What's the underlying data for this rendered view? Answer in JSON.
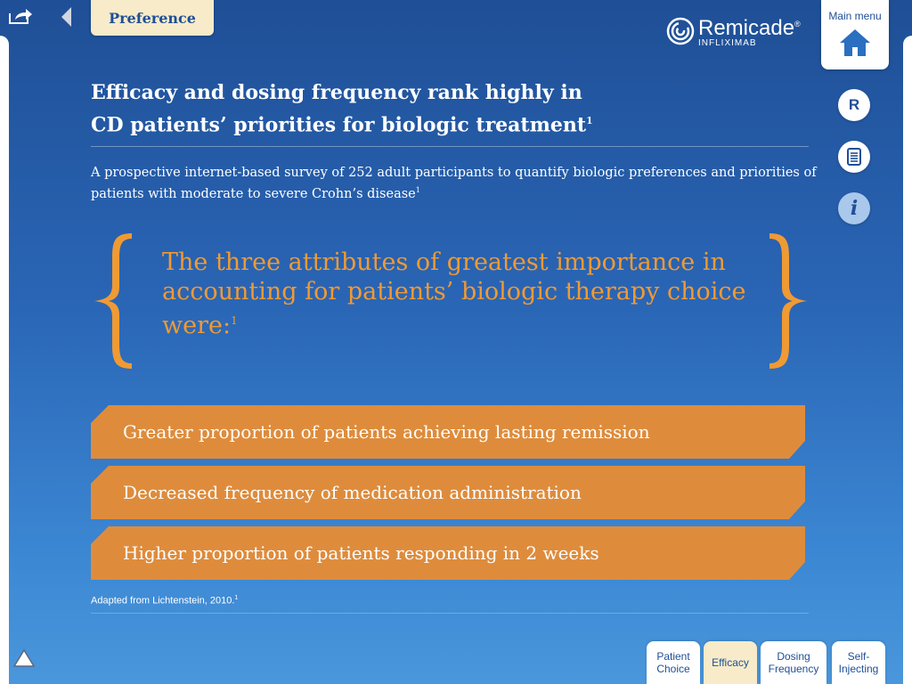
{
  "top_tab": {
    "label": "Preference"
  },
  "brand": {
    "name": "Remicade",
    "registered": "®",
    "sub": "INFLIXIMAB"
  },
  "main_menu": {
    "label": "Main menu"
  },
  "side_buttons": {
    "reference_label": "R",
    "info_label": "i"
  },
  "title": {
    "line1": "Efficacy and dosing frequency rank highly in",
    "line2": "CD patients’ priorities for biologic treatment",
    "sup": "1"
  },
  "subtitle": {
    "text": "A prospective internet-based survey of 252 adult participants to quantify biologic preferences and priorities of patients with moderate to severe Crohn’s disease",
    "sup": "1"
  },
  "quote": {
    "text": "The three attributes of greatest importance in accounting for patients’ biologic therapy choice were:",
    "sup": "1"
  },
  "attributes": [
    "Greater proportion of patients achieving lasting remission",
    "Decreased frequency of medication administration",
    "Higher proportion of patients responding in 2 weeks"
  ],
  "footnote": {
    "text": "Adapted from Lichtenstein, 2010.",
    "sup": "1"
  },
  "bottom_tabs": [
    {
      "label": "Patient Choice",
      "active": false
    },
    {
      "label": "Efficacy",
      "active": true
    },
    {
      "label": "Dosing Frequency",
      "active": false
    },
    {
      "label": "Self-Injecting",
      "active": false
    }
  ],
  "colors": {
    "background_top": "#1f4f96",
    "background_bottom": "#4a97dc",
    "accent_orange": "#f09a34",
    "bar_orange": "#de8c3c",
    "tab_cream": "#f7ebc9"
  }
}
